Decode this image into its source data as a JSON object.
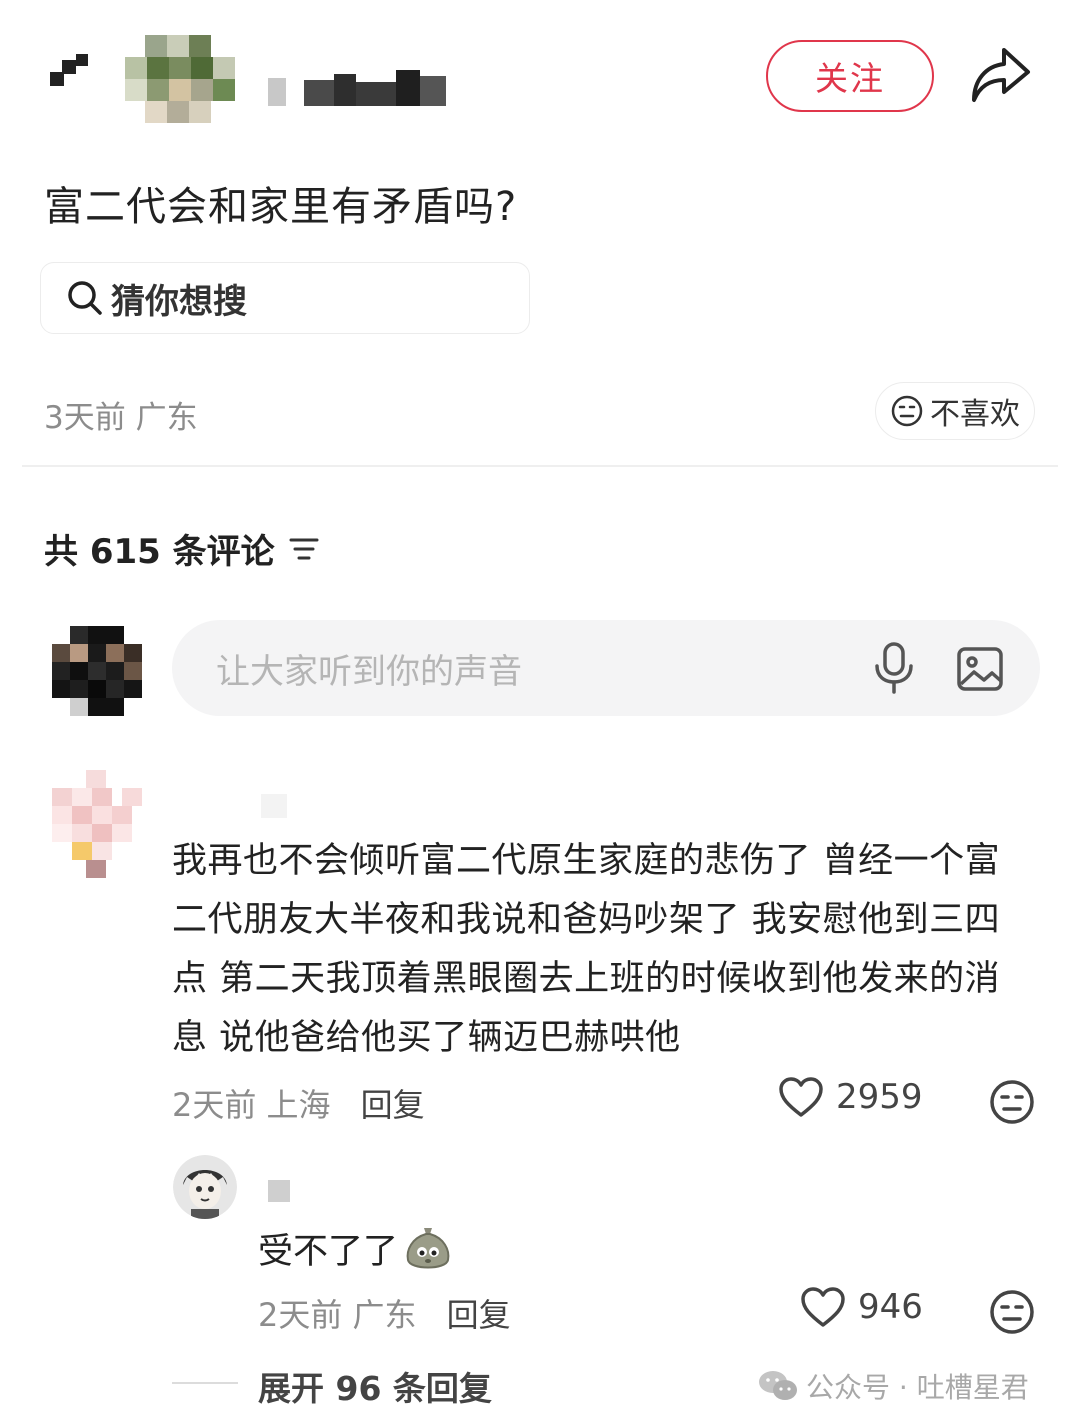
{
  "header": {
    "follow_label": "关注",
    "icons": {
      "back": "back-arrow-icon",
      "share": "share-icon"
    }
  },
  "post": {
    "title": "富二代会和家里有矛盾吗?",
    "search_chip_label": "猜你想搜",
    "meta": "3天前 广东",
    "dislike_label": "不喜欢"
  },
  "comments_section": {
    "count_label": "共 615 条评论",
    "input_placeholder": "让大家听到你的声音"
  },
  "comments": [
    {
      "text": "我再也不会倾听富二代原生家庭的悲伤了 曾经一个富二代朋友大半夜和我说和爸妈吵架了 我安慰他到三四点 第二天我顶着黑眼圈去上班的时候收到他发来的消息 说他爸给他买了辆迈巴赫哄他",
      "time": "2天前",
      "location": "上海",
      "reply_label": "回复",
      "likes": "2959"
    }
  ],
  "replies": [
    {
      "text": "受不了了",
      "time": "2天前",
      "location": "广东",
      "reply_label": "回复",
      "likes": "946"
    }
  ],
  "expand_label": "展开 96 条回复",
  "watermark": "公众号 · 吐槽星君",
  "colors": {
    "accent": "#e0364b",
    "muted": "#8c8c8c",
    "input_bg": "#f4f4f5"
  }
}
